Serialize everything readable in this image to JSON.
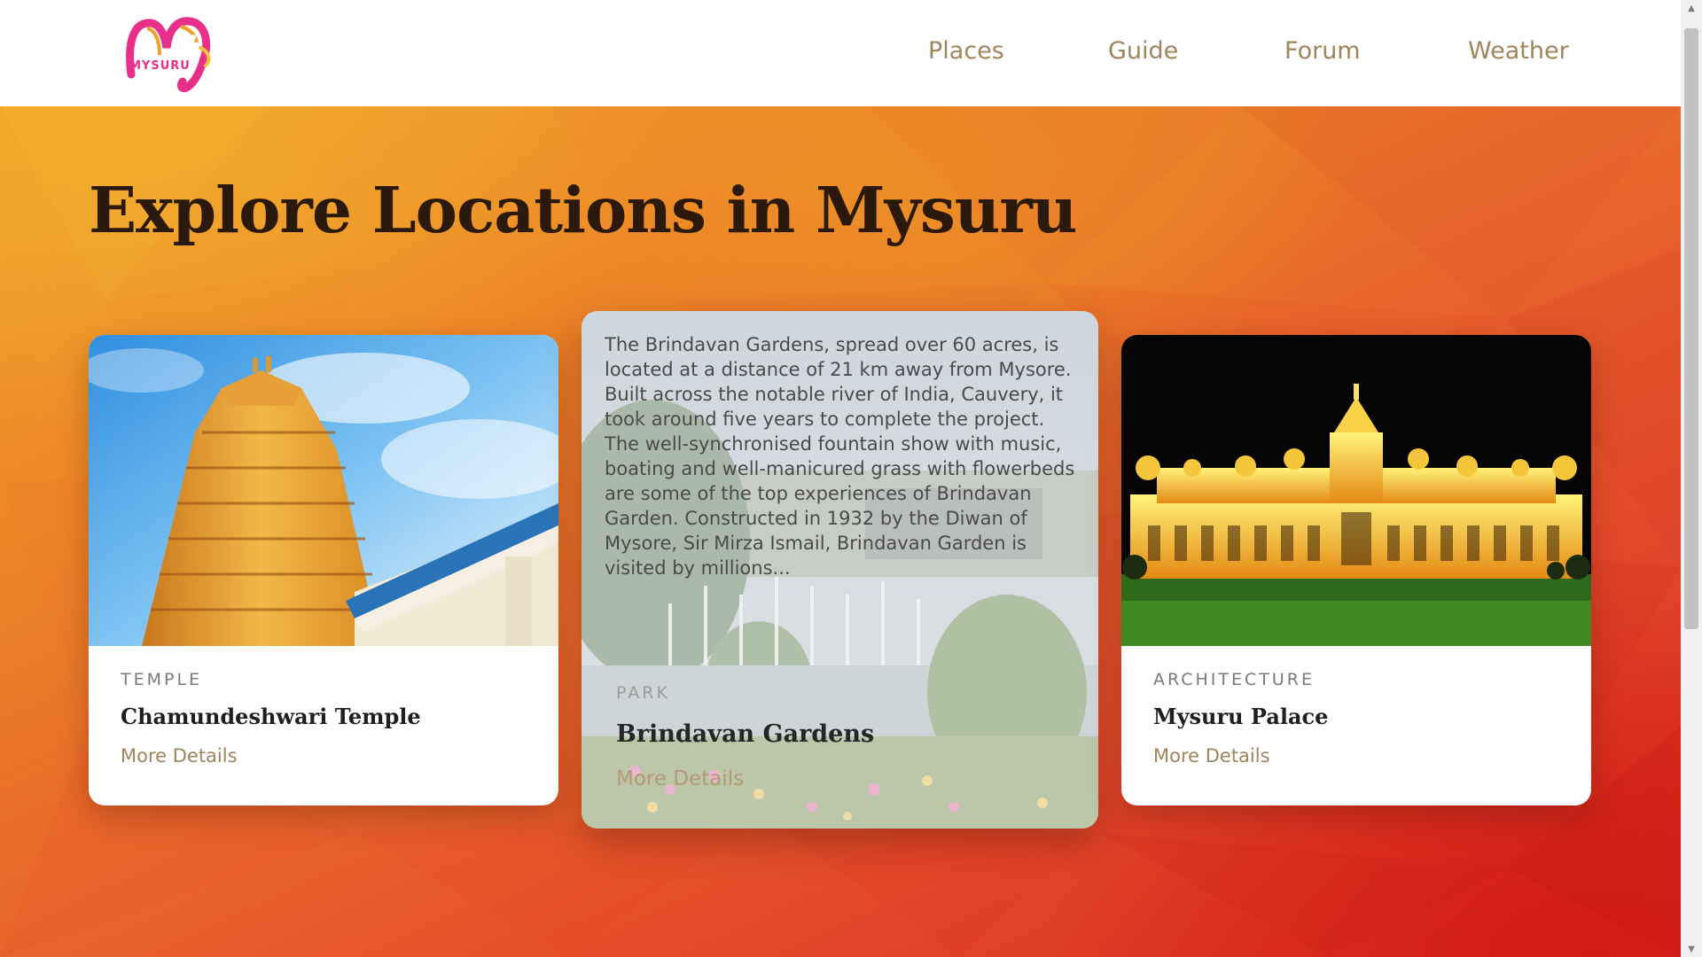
{
  "header": {
    "logo_text": "MYSURU",
    "nav": [
      "Places",
      "Guide",
      "Forum",
      "Weather"
    ]
  },
  "hero": {
    "title": "Explore Locations in Mysuru"
  },
  "cards": [
    {
      "category": "TEMPLE",
      "title": "Chamundeshwari Temple",
      "link": "More Details",
      "image_icon": "temple-gopuram-photo"
    },
    {
      "category": "PARK",
      "title": "Brindavan Gardens",
      "link": "More Details",
      "image_icon": "garden-fountain-photo",
      "description": "The Brindavan Gardens, spread over 60 acres, is located at a distance of 21 km away from Mysore. Built across the notable river of India, Cauvery, it took around five years to complete the project. The well-synchronised fountain show with music, boating and well-manicured grass with flowerbeds are some of the top experiences of Brindavan Garden. Constructed in 1932 by the Diwan of Mysore, Sir Mirza Ismail, Brindavan Garden is visited by millions..."
    },
    {
      "category": "ARCHITECTURE",
      "title": "Mysuru Palace",
      "link": "More Details",
      "image_icon": "palace-night-photo"
    }
  ],
  "colors": {
    "nav_text": "#a0845c",
    "hero_orange": "#ec8427",
    "hero_red": "#d82a1d",
    "title_text": "#2b1a0c"
  }
}
